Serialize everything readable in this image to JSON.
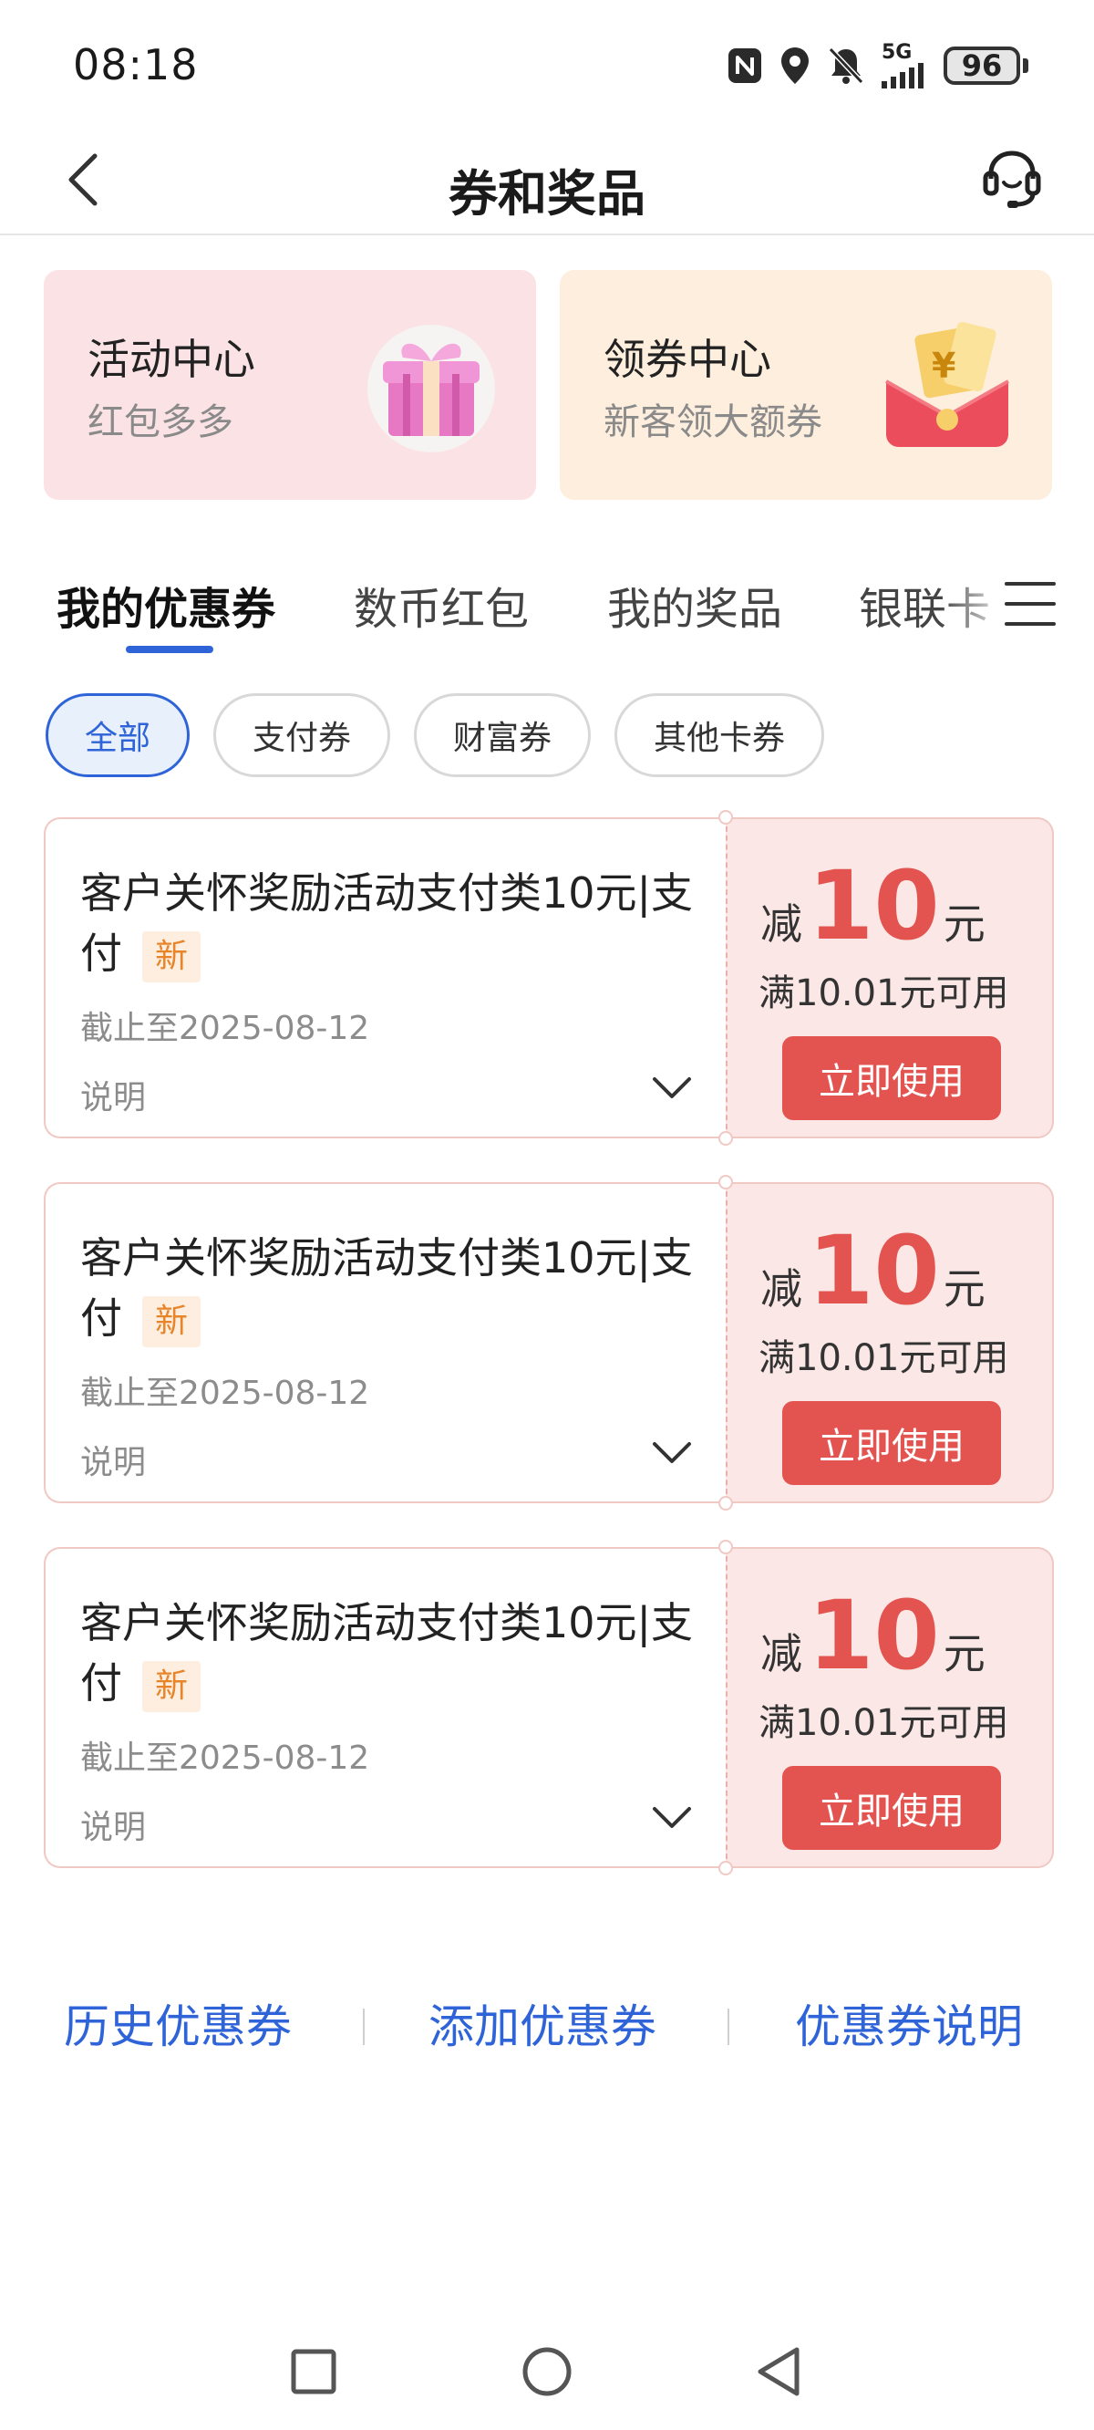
{
  "status_bar": {
    "time": "08:18",
    "network": "5G",
    "battery": "96",
    "icons": [
      "nfc-icon",
      "location-icon",
      "mute-icon",
      "signal-icon",
      "battery-icon"
    ]
  },
  "header": {
    "title": "券和奖品",
    "back_icon": "chevron-left-icon",
    "service_icon": "headset-icon"
  },
  "promos": [
    {
      "title": "活动中心",
      "subtitle": "红包多多",
      "icon": "gift-box-icon",
      "color": "#fbe3e5"
    },
    {
      "title": "领券中心",
      "subtitle": "新客领大额券",
      "icon": "red-envelope-icon",
      "color": "#fdeedd"
    }
  ],
  "tabs": [
    {
      "label": "我的优惠券",
      "active": true
    },
    {
      "label": "数币红包",
      "active": false
    },
    {
      "label": "我的奖品",
      "active": false
    },
    {
      "label": "银联卡",
      "active": false
    }
  ],
  "filters": [
    {
      "label": "全部",
      "active": true
    },
    {
      "label": "支付券",
      "active": false
    },
    {
      "label": "财富券",
      "active": false
    },
    {
      "label": "其他卡券",
      "active": false
    }
  ],
  "coupons": [
    {
      "name": "客户关怀奖励活动支付类10元|支付",
      "badge": "新",
      "expiry": "截止至2025-08-12",
      "desc_label": "说明",
      "prefix": "减",
      "amount": "10",
      "unit": "元",
      "condition": "满10.01元可用",
      "action": "立即使用"
    },
    {
      "name": "客户关怀奖励活动支付类10元|支付",
      "badge": "新",
      "expiry": "截止至2025-08-12",
      "desc_label": "说明",
      "prefix": "减",
      "amount": "10",
      "unit": "元",
      "condition": "满10.01元可用",
      "action": "立即使用"
    },
    {
      "name": "客户关怀奖励活动支付类10元|支付",
      "badge": "新",
      "expiry": "截止至2025-08-12",
      "desc_label": "说明",
      "prefix": "减",
      "amount": "10",
      "unit": "元",
      "condition": "满10.01元可用",
      "action": "立即使用"
    }
  ],
  "footer": {
    "history": "历史优惠券",
    "add": "添加优惠券",
    "info": "优惠券说明"
  },
  "colors": {
    "accent_blue": "#2f64d8",
    "accent_red": "#e35450",
    "badge_orange": "#e8852a"
  }
}
